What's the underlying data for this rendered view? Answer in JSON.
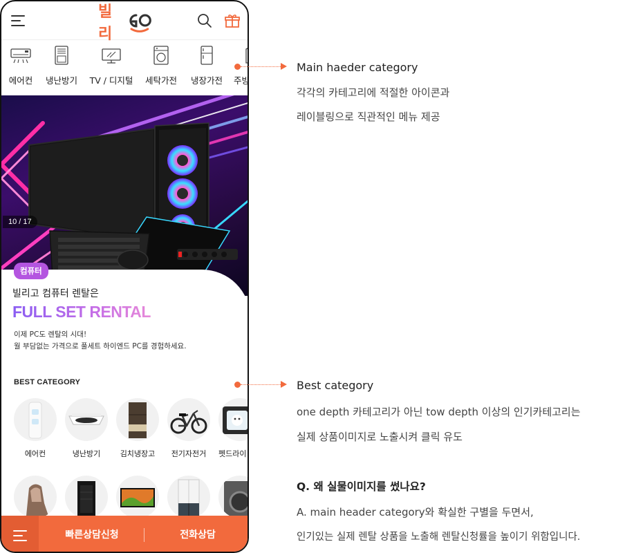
{
  "header": {
    "logo_text": "빌리",
    "logo_mark": "GO",
    "brand_color": "#f26a3d"
  },
  "categories": [
    {
      "label": "에어컨",
      "icon": "air-conditioner-icon"
    },
    {
      "label": "냉난방기",
      "icon": "heater-icon"
    },
    {
      "label": "TV / 디지털",
      "icon": "tv-icon"
    },
    {
      "label": "세탁가전",
      "icon": "washer-icon"
    },
    {
      "label": "냉장가전",
      "icon": "fridge-icon"
    },
    {
      "label": "주방",
      "icon": "kitchen-icon"
    }
  ],
  "hero": {
    "counter": "10 / 17",
    "badge": "컴퓨터",
    "subtitle": "빌리고 컴퓨터 렌탈은",
    "title": "FULL SET RENTAL",
    "desc_line1": "이제 PC도 렌탈의 시대!",
    "desc_line2": "월 부담없는 가격으로 풀세트 하이엔드 PC를 경험하세요."
  },
  "best": {
    "title": "BEST CATEGORY",
    "row1": [
      {
        "label": "에어컨"
      },
      {
        "label": "냉난방기"
      },
      {
        "label": "김치냉장고"
      },
      {
        "label": "전기자전거"
      },
      {
        "label": "펫드라이"
      }
    ],
    "row2": [
      {
        "label": ""
      },
      {
        "label": ""
      },
      {
        "label": ""
      },
      {
        "label": ""
      },
      {
        "label": ""
      }
    ]
  },
  "bottom_bar": {
    "quick_consult": "빠른상담신청",
    "phone_consult": "전화상담"
  },
  "annotations": {
    "a1_head": "Main haeder category",
    "a1_line1": "각각의 카테고리에 적절한 아이콘과",
    "a1_line2": "레이블링으로 직관적인 메뉴 제공",
    "a2_head": "Best category",
    "a2_line1": "one depth 카테고리가 아닌 tow depth 이상의 인기카테고리는",
    "a2_line2": "실제 상품이미지로 노출시켜 클릭 유도",
    "q": "Q. 왜 실물이미지를 썼나요?",
    "a_line1": "A. main header category와 확실한 구별을 두면서,",
    "a_line2": "인기있는 실제 렌탈 상품을 노출해 렌탈신청률을 높이기 위함입니다."
  }
}
